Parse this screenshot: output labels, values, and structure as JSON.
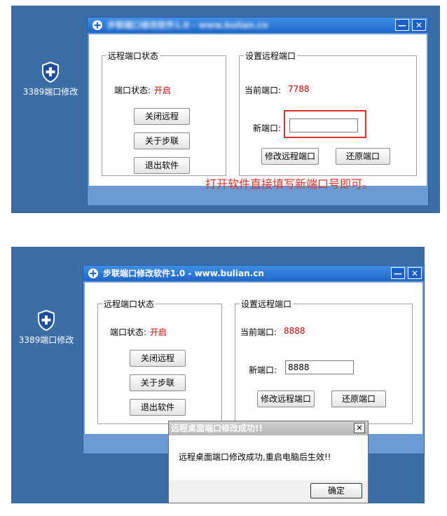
{
  "desktop_icon": {
    "label": "3389端口修改",
    "icon": "shield-plus-icon"
  },
  "window_top": {
    "title": "步联端口修改软件1.0 - www.bulian.cn",
    "minimize_label": "—",
    "close_label": "✕",
    "left_group": {
      "legend": "远程端口状态",
      "status_label": "端口状态:",
      "status_value": "开启",
      "buttons": [
        "关闭远程",
        "关于步联",
        "退出软件"
      ]
    },
    "right_group": {
      "legend": "设置远程端口",
      "current_label": "当前端口:",
      "current_value": "7788",
      "new_label": "新端口:",
      "new_value": "",
      "modify_button": "修改远程端口",
      "restore_button": "还原端口"
    },
    "annotation": "打开软件直接填写新端口号即可。"
  },
  "window_bottom": {
    "title": "步联端口修改软件1.0 - www.bulian.cn",
    "minimize_label": "—",
    "close_label": "✕",
    "left_group": {
      "legend": "远程端口状态",
      "status_label": "端口状态:",
      "status_value": "开启",
      "buttons": [
        "关闭远程",
        "关于步联",
        "退出软件"
      ]
    },
    "right_group": {
      "legend": "设置远程端口",
      "current_label": "当前端口:",
      "current_value": "8888",
      "new_label": "新端口:",
      "new_value": "8888",
      "modify_button": "修改远程端口",
      "restore_button": "还原端口"
    }
  },
  "dialog": {
    "title": "远程桌面端口修改成功!!",
    "message": "远程桌面端口修改成功,重启电脑后生效!!",
    "close_label": "✕",
    "ok_button": "确定"
  },
  "colors": {
    "desktop": "#3a6ea5",
    "titlebar": "#1f66c8",
    "status": "#cc0000",
    "annotation": "#e0302a"
  }
}
